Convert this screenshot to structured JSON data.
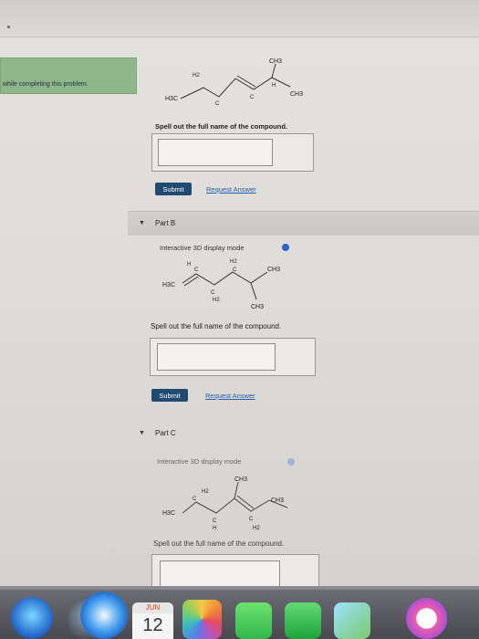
{
  "banner": {
    "text": "while completing this problem."
  },
  "part_a": {
    "molecule": {
      "ch3_top": "CH3",
      "h2": "H2",
      "c1": "C",
      "c2": "C",
      "h": "H",
      "h3c": "H3C",
      "ch3_right": "CH3"
    },
    "prompt": "Spell out the full name of the compound.",
    "submit_label": "Submit",
    "request_label": "Request Answer"
  },
  "part_b": {
    "label": "Part B",
    "mode": "Interactive 3D display mode",
    "molecule": {
      "h": "H",
      "h2": "H2",
      "c1": "C",
      "c2": "C",
      "c3": "C",
      "ch3_right": "CH3",
      "h3c": "H3C",
      "h2_low": "H2",
      "ch3_bottom": "CH3"
    },
    "prompt": "Spell out the full name of the compound.",
    "submit_label": "Submit",
    "request_label": "Request Answer"
  },
  "part_c": {
    "label": "Part C",
    "mode": "Interactive 3D display mode",
    "molecule": {
      "ch3_top": "CH3",
      "h2": "H2",
      "c1": "C",
      "c2": "C",
      "c3": "C",
      "h3c": "H3C",
      "ch3_right": "CH3",
      "h_low": "H",
      "h2_low": "H2"
    },
    "prompt": "Spell out the full name of the compound."
  },
  "dock": {
    "calendar_month": "JUN",
    "calendar_day": "12"
  },
  "colors": {
    "submit": "#204a70",
    "link": "#1f5ea8",
    "banner": "#8fb58a",
    "info": "#2c63c9"
  }
}
